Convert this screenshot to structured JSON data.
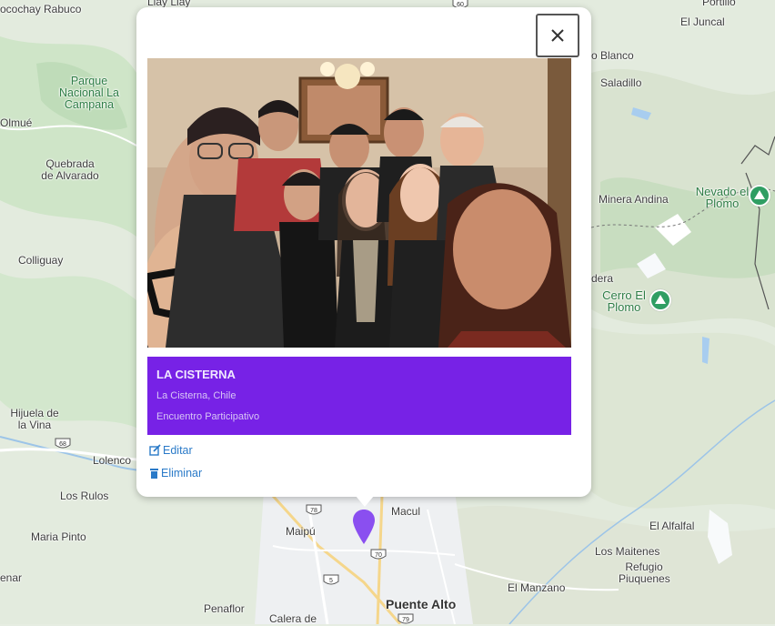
{
  "map": {
    "labels": {
      "cocochay": "ocochay",
      "rabuco": "Rabuco",
      "llay_llay": "Llay Llay",
      "portillo": "Portillo",
      "el_juncal": "El Juncal",
      "blanco": "o Blanco",
      "saladillo": "Saladillo",
      "parque_campana": "Parque Nacional La Campana",
      "olmue": "Olmué",
      "quebrada": "Quebrada de Alvarado",
      "minera_andina": "Minera Andina",
      "nevado_plomo": "Nevado el Plomo",
      "colliguay": "Colliguay",
      "dera": "dera",
      "cerro_plomo": "Cerro El Plomo",
      "hijuela": "Hijuela de la Vina",
      "lolenco": "Lolenco",
      "los_rulos": "Los Rulos",
      "maipu": "Maipú",
      "macul": "Macul",
      "el_alfalfal": "El Alfalfal",
      "maria_pinto": "Maria Pinto",
      "los_maitenes": "Los Maitenes",
      "refugio": "Refugio Piuquenes",
      "enar": "enar",
      "el_manzano": "El Manzano",
      "penaflor": "Penaflor",
      "puente_alto": "Puente Alto",
      "calera": "Calera de"
    },
    "shields": [
      "68",
      "78",
      "70",
      "5",
      "79",
      "60"
    ],
    "colors": {
      "land": "#e6ede2",
      "park": "#c6e3c3",
      "water": "#a8cdef",
      "road": "#ffffff",
      "highway": "#f5d68b"
    }
  },
  "popup": {
    "close_icon": "close-icon",
    "photo_alt": "Foto grupal del encuentro",
    "card": {
      "title": "LA CISTERNA",
      "location": "La Cisterna, Chile",
      "type": "Encuentro Participativo",
      "color": "#7722e6"
    },
    "actions": {
      "edit": "Editar",
      "delete": "Eliminar"
    }
  },
  "marker": {
    "color": "#8a4ff0"
  }
}
